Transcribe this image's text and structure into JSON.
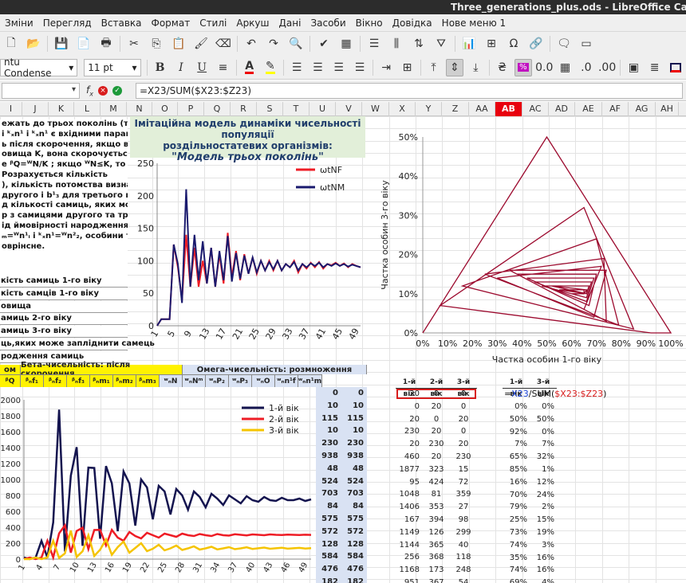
{
  "window": {
    "title": "Three_generations_plus.ods - LibreOffice Calc"
  },
  "menu": [
    "Зміни",
    "Перегляд",
    "Вставка",
    "Формат",
    "Стилі",
    "Аркуш",
    "Дані",
    "Засоби",
    "Вікно",
    "Довідка",
    "Нове меню 1"
  ],
  "toolbar": {
    "font_name": "ntu Condense",
    "font_size": "11 pt",
    "bold": "B",
    "italic": "I",
    "underline": "U",
    "icons": [
      "new-icon",
      "open-icon",
      "save-icon",
      "export-pdf-icon",
      "print-icon",
      "cut-icon",
      "copy-icon",
      "paste-icon",
      "clone-icon",
      "clear-icon",
      "undo-icon",
      "redo-icon",
      "find-icon",
      "spellcheck-icon",
      "table-icon",
      "row-icon",
      "column-icon",
      "sort-icon",
      "autofilter-icon",
      "chart-icon",
      "pivot-icon",
      "special-char-icon",
      "link-icon",
      "comment-icon",
      "header-footer-icon"
    ]
  },
  "formula_bar": {
    "name_box": "",
    "formula": "=X23/SUM($X23:$Z23)"
  },
  "columns": [
    "I",
    "J",
    "K",
    "L",
    "M",
    "N",
    "O",
    "P",
    "Q",
    "R",
    "S",
    "T",
    "U",
    "V",
    "W",
    "X",
    "Y",
    "Z",
    "AA",
    "AB",
    "AC",
    "AD",
    "AE",
    "AF",
    "AG",
    "AH"
  ],
  "selected_column": "AB",
  "description_lines": [
    "ежать до трьох поколінь (трьох",
    "i ᵏₓn¹ і ᵏₓn¹ є вхідними параметрами, а",
    "ь після скорочення, якщо воно",
    "овища K, вона скорочується до K.",
    "е ᵝQ=ᵂN/K ; якщо ᵂN≤K, то ᵝn¹=ᵂn¹.",
    "Розрахується кількість",
    "), кількість потомства визначає",
    "другого і b¹₃ для третього віку).",
    "д кількості самиць, яких може",
    "р з самицями другого та третього",
    "ід ймовірності народження самиць,",
    "ₘ=ᵂn¹ᵢ і ᵏₓn¹=ᵂn²₂, особини третього",
    "оврінсне."
  ],
  "left_labels": [
    "кість самиць 1-го віку",
    "кість самців 1-го віку",
    "овища",
    "амиць 2-го віку",
    "амиць 3-го віку",
    "ць,яких може запліднити самець",
    "родження самиць"
  ],
  "title_box": {
    "line1": "Імітаційна модель  динаміки чисельності популяції",
    "line2": "роздільностатевих організмів:",
    "line3": "\"Модель трьох поколінь\""
  },
  "header_row": {
    "left": "ом",
    "beta": "Бета-чисельність: після скорочення",
    "omega": "Омега-чисельність: розмноження",
    "sub": [
      "ᵝQ",
      "ᵝₙf₁",
      "ᵝₙf₂",
      "ᵝₙf₃",
      "ᵝₙm₁",
      "ᵝₙm₂",
      "ᵝₙm₃",
      "ʷₙN",
      "ʷₙNᵐ",
      "ʷₙP₂",
      "ʷₙP₃",
      "ʷₙO",
      "ʷₙn¹f",
      "ʷₙn¹m"
    ]
  },
  "pair_column": [
    [
      "0",
      "0"
    ],
    [
      "10",
      "10"
    ],
    [
      "115",
      "115"
    ],
    [
      "10",
      "10"
    ],
    [
      "230",
      "230"
    ],
    [
      "938",
      "938"
    ],
    [
      "48",
      "48"
    ],
    [
      "524",
      "524"
    ],
    [
      "703",
      "703"
    ],
    [
      "84",
      "84"
    ],
    [
      "575",
      "575"
    ],
    [
      "572",
      "572"
    ],
    [
      "128",
      "128"
    ],
    [
      "584",
      "584"
    ],
    [
      "476",
      "476"
    ],
    [
      "182",
      "182"
    ]
  ],
  "age_table": {
    "headers": [
      "1-й вік",
      "2-й вік",
      "3-й вік"
    ],
    "rows": [
      [
        "20",
        "0",
        "0"
      ],
      [
        "0",
        "20",
        "0"
      ],
      [
        "20",
        "0",
        "20"
      ],
      [
        "230",
        "20",
        "0"
      ],
      [
        "20",
        "230",
        "20"
      ],
      [
        "460",
        "20",
        "230"
      ],
      [
        "1877",
        "323",
        "15"
      ],
      [
        "95",
        "424",
        "72"
      ],
      [
        "1048",
        "81",
        "359"
      ],
      [
        "1406",
        "353",
        "27"
      ],
      [
        "167",
        "394",
        "98"
      ],
      [
        "1149",
        "126",
        "299"
      ],
      [
        "1144",
        "365",
        "40"
      ],
      [
        "256",
        "368",
        "118"
      ],
      [
        "1168",
        "173",
        "248"
      ],
      [
        "951",
        "367",
        "54"
      ]
    ]
  },
  "share_table": {
    "headers": [
      "1-й вік",
      "3-й вік"
    ],
    "edit_formula_prefix": "=",
    "edit_formula_ref": "X23",
    "edit_formula_mid": "/SUM(",
    "edit_formula_range": "$X23:$Z23",
    "edit_formula_end": ")",
    "rows": [
      [
        "0%",
        "0%"
      ],
      [
        "50%",
        "50%"
      ],
      [
        "92%",
        "0%"
      ],
      [
        "7%",
        "7%"
      ],
      [
        "65%",
        "32%"
      ],
      [
        "85%",
        "1%"
      ],
      [
        "16%",
        "12%"
      ],
      [
        "70%",
        "24%"
      ],
      [
        "79%",
        "2%"
      ],
      [
        "25%",
        "15%"
      ],
      [
        "73%",
        "19%"
      ],
      [
        "74%",
        "3%"
      ],
      [
        "35%",
        "16%"
      ],
      [
        "74%",
        "16%"
      ],
      [
        "69%",
        "4%"
      ]
    ]
  },
  "chart_data": [
    {
      "type": "line",
      "title": "",
      "x_ticks": [
        "1",
        "5",
        "9",
        "13",
        "17",
        "21",
        "25",
        "29",
        "33",
        "37",
        "41",
        "45",
        "49"
      ],
      "ylim": [
        0,
        250
      ],
      "y_ticks": [
        "0",
        "50",
        "100",
        "150",
        "200",
        "250"
      ],
      "series": [
        {
          "name": "ωtNF",
          "color": "#ee1c25",
          "values": [
            0,
            10,
            10,
            10,
            125,
            90,
            40,
            140,
            60,
            120,
            60,
            100,
            65,
            120,
            60,
            110,
            65,
            143,
            75,
            115,
            70,
            110,
            80,
            105,
            80,
            100,
            85,
            100,
            85,
            100,
            85,
            95,
            90,
            100,
            82,
            95,
            88,
            97,
            90,
            98,
            88,
            95,
            93,
            97,
            92,
            96,
            90,
            95,
            92,
            90
          ]
        },
        {
          "name": "ωtNM",
          "color": "#1a1a6e",
          "values": [
            0,
            10,
            10,
            10,
            125,
            95,
            35,
            210,
            60,
            140,
            70,
            130,
            65,
            120,
            60,
            115,
            70,
            138,
            68,
            112,
            72,
            108,
            80,
            105,
            82,
            100,
            85,
            98,
            87,
            100,
            85,
            95,
            90,
            98,
            85,
            95,
            90,
            96,
            92,
            97,
            90,
            95,
            92,
            96,
            92,
            95,
            91,
            94,
            92,
            90
          ]
        }
      ]
    },
    {
      "type": "line",
      "title": "",
      "x_ticks": [
        "1",
        "4",
        "7",
        "10",
        "13",
        "16",
        "19",
        "22",
        "25",
        "28",
        "31",
        "34",
        "37",
        "40",
        "43",
        "46",
        "49"
      ],
      "ylim": [
        0,
        2000
      ],
      "y_ticks": [
        "0",
        "200",
        "400",
        "600",
        "800",
        "1000",
        "1200",
        "1400",
        "1600",
        "1800",
        "2000"
      ],
      "series": [
        {
          "name": "1-й вік",
          "color": "#14144f",
          "values": [
            20,
            0,
            20,
            230,
            20,
            460,
            1877,
            95,
            1048,
            1406,
            167,
            1149,
            1144,
            256,
            1168,
            951,
            350,
            1100,
            950,
            420,
            1000,
            900,
            500,
            920,
            850,
            560,
            880,
            800,
            620,
            850,
            780,
            650,
            820,
            760,
            680,
            800,
            750,
            700,
            790,
            740,
            720,
            780,
            740,
            730,
            770,
            740,
            740,
            760,
            730,
            750
          ]
        },
        {
          "name": "2-й вік",
          "color": "#ee1c25",
          "values": [
            0,
            20,
            0,
            20,
            230,
            20,
            323,
            424,
            81,
            353,
            394,
            126,
            365,
            368,
            173,
            367,
            270,
            230,
            340,
            290,
            260,
            330,
            300,
            270,
            320,
            300,
            280,
            320,
            300,
            290,
            315,
            300,
            290,
            315,
            300,
            295,
            312,
            305,
            298,
            310,
            305,
            300,
            310,
            305,
            302,
            308,
            305,
            303,
            306,
            304
          ]
        },
        {
          "name": "3-й вік",
          "color": "#f5c400",
          "values": [
            0,
            0,
            20,
            0,
            20,
            230,
            15,
            72,
            359,
            27,
            98,
            299,
            40,
            118,
            248,
            54,
            150,
            220,
            80,
            140,
            200,
            100,
            130,
            180,
            110,
            135,
            170,
            115,
            135,
            160,
            120,
            135,
            155,
            122,
            135,
            150,
            125,
            135,
            148,
            128,
            136,
            145,
            130,
            136,
            143,
            131,
            136,
            141,
            133,
            137
          ]
        }
      ]
    },
    {
      "type": "line",
      "title": "",
      "xlabel": "Частка особин 1-го віку",
      "ylabel": "Частка особин 3-го віку",
      "xlim": [
        0,
        100
      ],
      "ylim": [
        0,
        50
      ],
      "x_ticks": [
        "0%",
        "10%",
        "20%",
        "30%",
        "40%",
        "50%",
        "60%",
        "70%",
        "80%",
        "90%",
        "100%"
      ],
      "y_ticks": [
        "0%",
        "10%",
        "20%",
        "30%",
        "40%",
        "50%"
      ],
      "series": [
        {
          "name": "",
          "color": "#9c0a2e",
          "x": [
            0,
            50,
            100,
            92,
            7,
            65,
            85,
            16,
            70,
            79,
            25,
            73,
            74,
            35,
            74,
            69,
            30,
            72,
            65,
            38,
            70,
            67,
            42,
            69,
            66,
            45,
            68,
            66,
            48,
            67,
            66,
            52,
            66,
            66,
            55,
            66,
            65,
            58,
            65,
            65,
            60,
            65,
            64,
            62,
            64,
            63,
            63,
            64,
            63
          ],
          "y": [
            0,
            50,
            0,
            0,
            7,
            32,
            1,
            12,
            24,
            2,
            15,
            19,
            3,
            16,
            16,
            4,
            14,
            17,
            6,
            15,
            15,
            7,
            14,
            14,
            8,
            13,
            13,
            9,
            12,
            12,
            10,
            12,
            11,
            10,
            11,
            11,
            10,
            11,
            11,
            10,
            10,
            10,
            10,
            10,
            10,
            10,
            10,
            10,
            10
          ]
        }
      ]
    }
  ]
}
